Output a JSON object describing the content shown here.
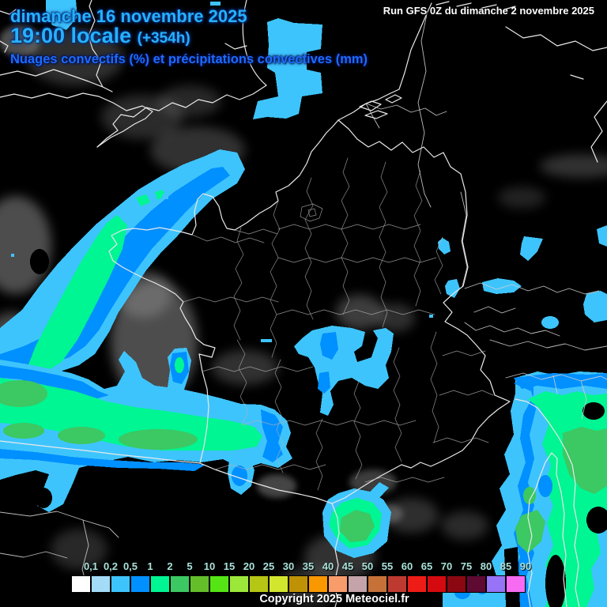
{
  "header": {
    "date": "dimanche 16 novembre 2025",
    "time": "19:00 locale",
    "offset": "(+354h)",
    "subtitle": "Nuages convectifs (%) et précipitations convectives (mm)",
    "run_info": "Run GFS 0Z du dimanche 2 novembre 2025"
  },
  "legend": {
    "values": [
      "0,1",
      "0,2",
      "0,5",
      "1",
      "2",
      "5",
      "10",
      "15",
      "20",
      "25",
      "30",
      "35",
      "40",
      "45",
      "50",
      "55",
      "60",
      "65",
      "70",
      "75",
      "80",
      "85",
      "90"
    ],
    "colors": [
      "#ffffff",
      "#a4dcf8",
      "#3ec4fc",
      "#0090ff",
      "#00f593",
      "#3cc862",
      "#64be2a",
      "#55e414",
      "#9ce83a",
      "#b6c614",
      "#d2e62e",
      "#be9204",
      "#fa9800",
      "#f99c6c",
      "#c4a4aa",
      "#c67138",
      "#be3a30",
      "#ee1c16",
      "#d40a10",
      "#8b0712",
      "#5e0a32",
      "#9673f7",
      "#f76bf3"
    ]
  },
  "footer": {
    "copyright": "Copyright 2025 Meteociel.fr"
  },
  "map": {
    "background": "#000000",
    "palette": {
      "precip_light": "#3ec4fc",
      "precip_moderate": "#0090ff",
      "precip_heavy": "#00f593",
      "precip_intense": "#3cc862",
      "cloud_gray": "#9a9a9a",
      "coastline": "#e9e9e9",
      "department_border": "#b3b3b3"
    }
  }
}
